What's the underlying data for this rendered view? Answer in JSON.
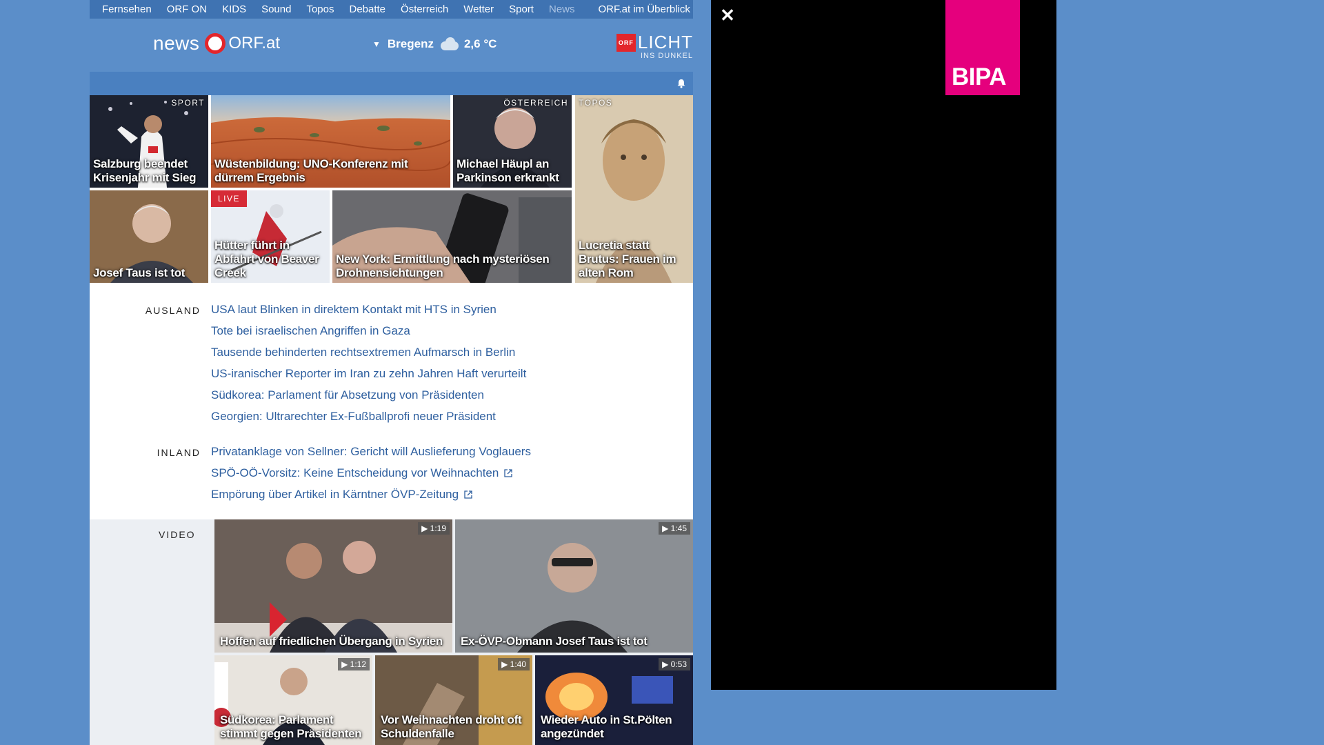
{
  "nav": {
    "items": [
      "Fernsehen",
      "ORF ON",
      "KIDS",
      "Sound",
      "Topos",
      "Debatte",
      "Österreich",
      "Wetter",
      "Sport",
      "News"
    ],
    "overview": "ORF.at im Überblick"
  },
  "header": {
    "logo_news": "news",
    "logo_orf": "ORF.at",
    "weather_location": "Bregenz",
    "weather_temp": "2,6 °C",
    "licht_badge": "ORF",
    "licht_title": "LICHT",
    "licht_sub": "INS DUNKEL"
  },
  "tiles": [
    {
      "caption": "Salzburg beendet Krisenjahr mit Sieg",
      "tag": "SPORT"
    },
    {
      "caption": "Wüstenbildung: UNO-Konferenz mit dürrem Ergebnis",
      "tag": ""
    },
    {
      "caption": "Michael Häupl an Parkinson erkrankt",
      "tag": "ÖSTERREICH"
    },
    {
      "caption": "Lucretia statt Brutus: Frauen im alten Rom",
      "tag": "TOPOS"
    },
    {
      "caption": "Josef Taus ist tot",
      "tag": ""
    },
    {
      "caption": "Hütter führt in Abfahrt von Beaver Creek",
      "tag": "LIVE"
    },
    {
      "caption": "New York: Ermittlung nach mysteriösen Drohnensichtungen",
      "tag": ""
    }
  ],
  "sections": {
    "ausland": {
      "label": "AUSLAND",
      "items": [
        "USA laut Blinken in direktem Kontakt mit HTS in Syrien",
        "Tote bei israelischen Angriffen in Gaza",
        "Tausende behinderten rechtsextremen Aufmarsch in Berlin",
        "US-iranischer Reporter im Iran zu zehn Jahren Haft verurteilt",
        "Südkorea: Parlament für Absetzung von Präsidenten",
        "Georgien: Ultrarechter Ex-Fußballprofi neuer Präsident"
      ]
    },
    "inland": {
      "label": "INLAND",
      "items": [
        "Privatanklage von Sellner: Gericht will Auslieferung Voglauers",
        "SPÖ-OÖ-Vorsitz: Keine Entscheidung vor Weihnachten",
        "Empörung über Artikel in Kärntner ÖVP-Zeitung"
      ]
    }
  },
  "video": {
    "label": "VIDEO",
    "items": [
      {
        "caption": "Hoffen auf friedlichen Übergang in Syrien",
        "duration": "1:19"
      },
      {
        "caption": "Ex-ÖVP-Obmann Josef Taus ist tot",
        "duration": "1:45"
      },
      {
        "caption": "Südkorea: Parlament stimmt gegen Präsidenten",
        "duration": "1:12"
      },
      {
        "caption": "Vor Weihnachten droht oft Schuldenfalle",
        "duration": "1:40"
      },
      {
        "caption": "Wieder Auto in St.Pölten angezündet",
        "duration": "0:53"
      }
    ]
  },
  "ad": {
    "brand": "BIPA",
    "close": "✕",
    "brand_color": "#e5007d"
  },
  "colors": {
    "page_bg": "#5b8ec9",
    "nav_bg": "#3f73b2",
    "link": "#2e5f9f",
    "live_red": "#d62b36"
  }
}
